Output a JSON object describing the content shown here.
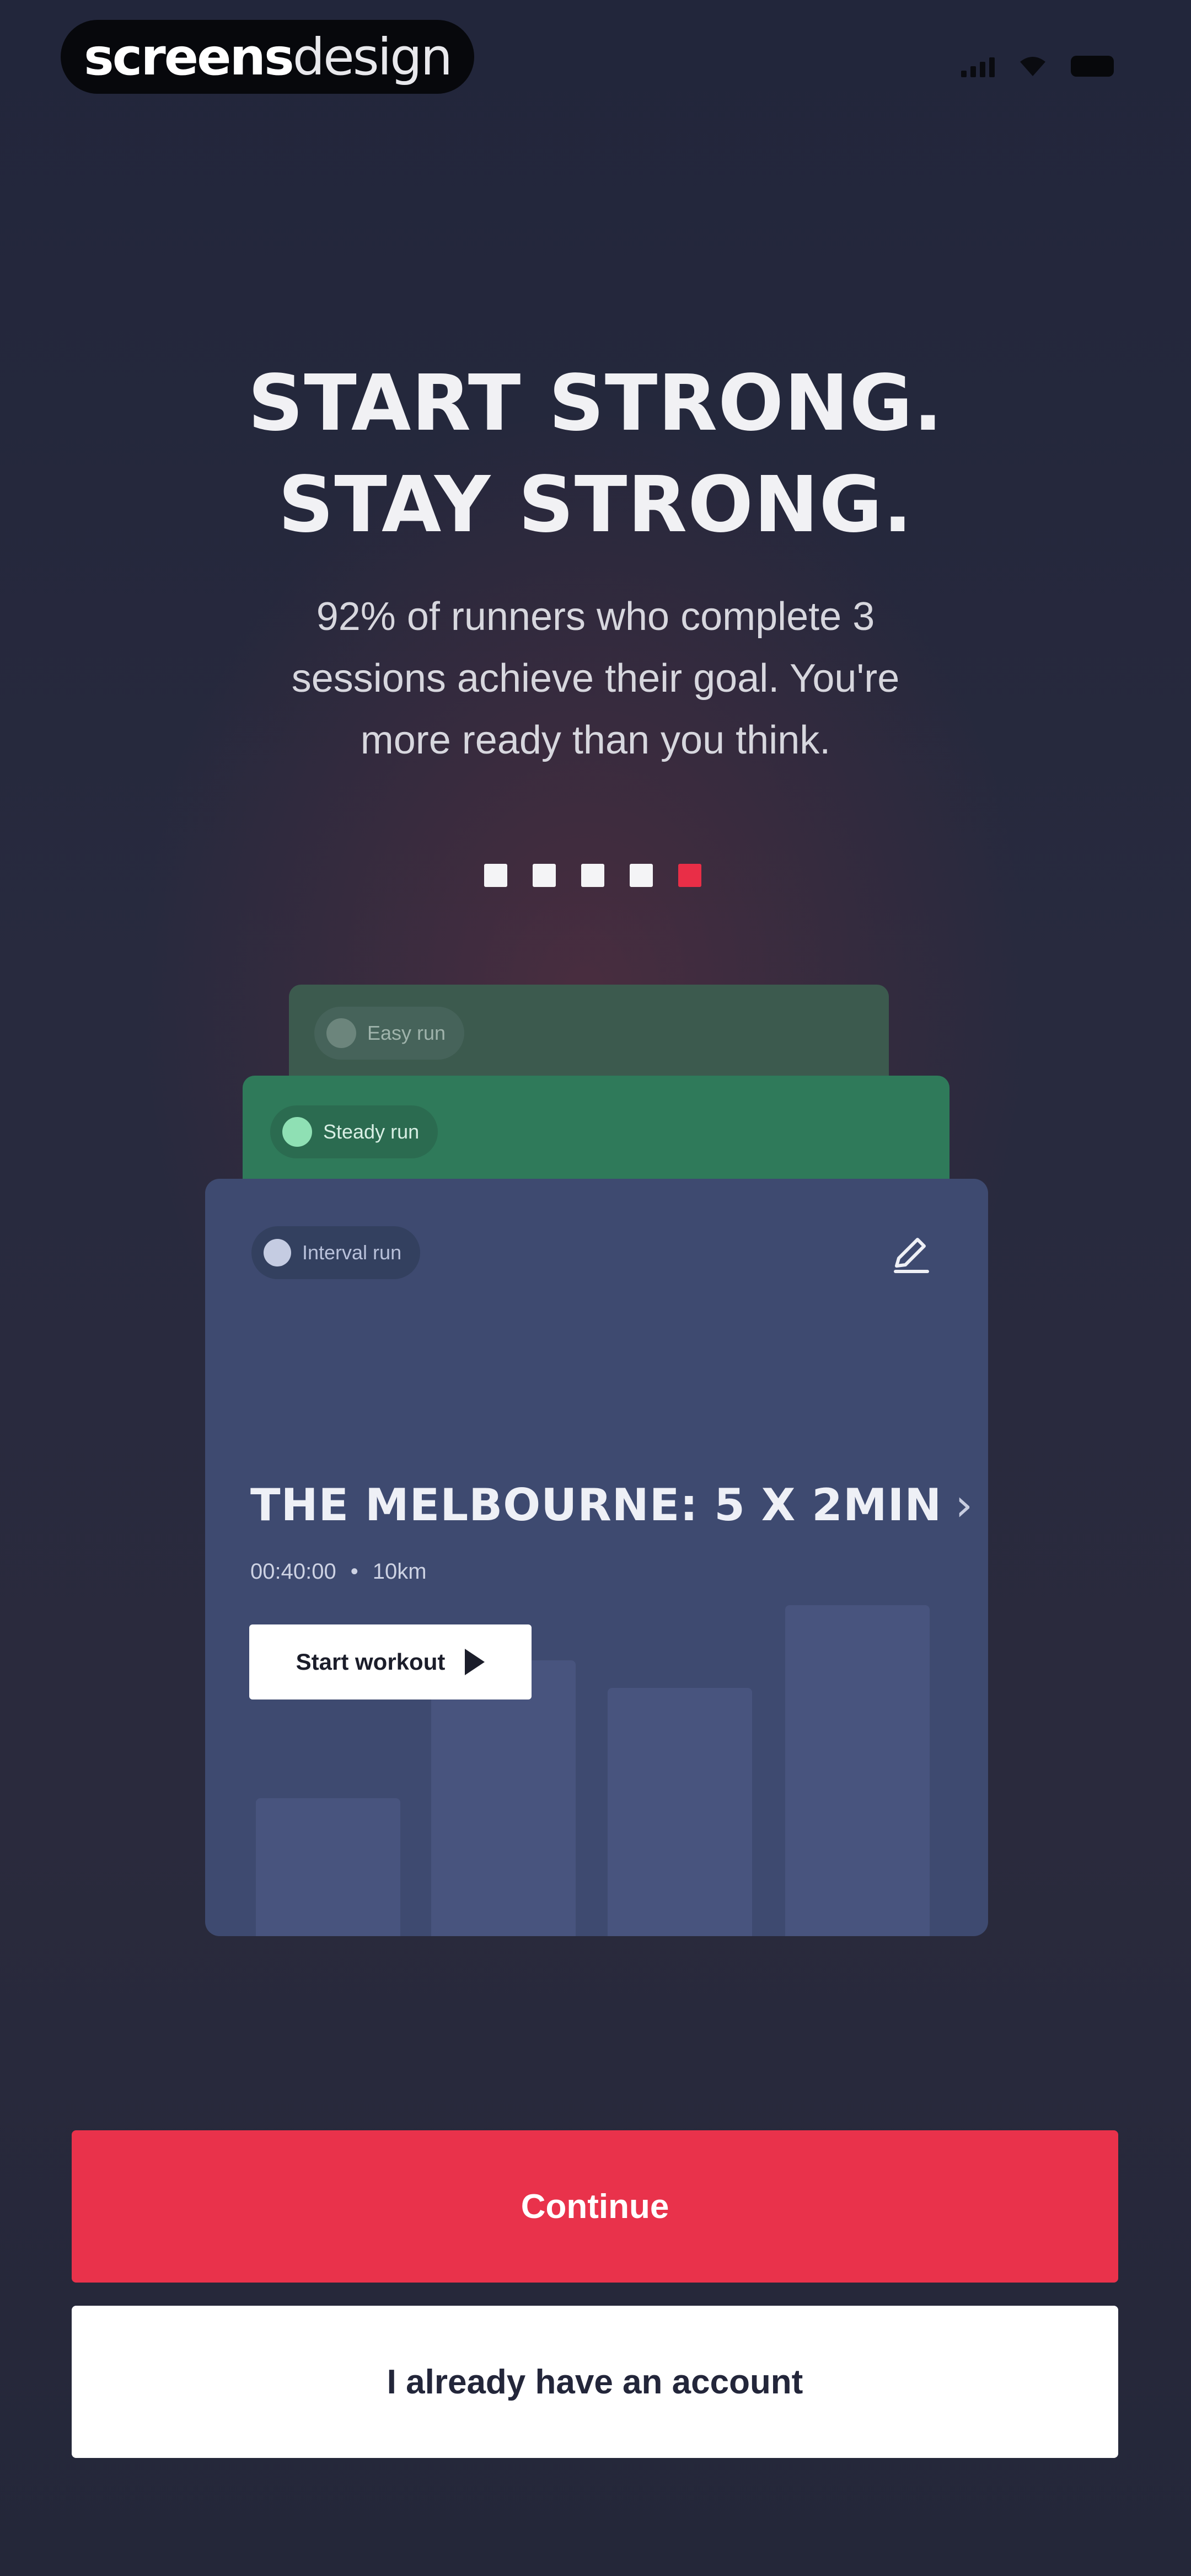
{
  "watermark": {
    "part1": "screens",
    "part2": "design"
  },
  "status_bar": {
    "icons": [
      "signal-icon",
      "wifi-icon",
      "battery-icon"
    ]
  },
  "headline": {
    "line1": "START STRONG.",
    "line2": "STAY STRONG."
  },
  "subtitle": {
    "line1": "92% of runners who complete 3",
    "line2": "sessions achieve their goal. You're",
    "line3": "more ready than you think."
  },
  "pagination": {
    "total": 5,
    "active_index": 4,
    "active_color": "#e92e47"
  },
  "cards": {
    "back": {
      "tag": "Easy run"
    },
    "middle": {
      "tag": "Steady run"
    },
    "front": {
      "tag": "Interval run",
      "title": "THE MELBOURNE: 5 X 2MIN",
      "duration": "00:40:00",
      "separator": "•",
      "distance": "10km",
      "start_label": "Start workout",
      "bar_levels": [
        0.25,
        0.5,
        0.45,
        0.6
      ]
    }
  },
  "actions": {
    "continue_label": "Continue",
    "account_label": "I already have an account"
  },
  "colors": {
    "accent": "#e9324b",
    "card": "#3e4a70",
    "green": "#2f7a5a"
  }
}
